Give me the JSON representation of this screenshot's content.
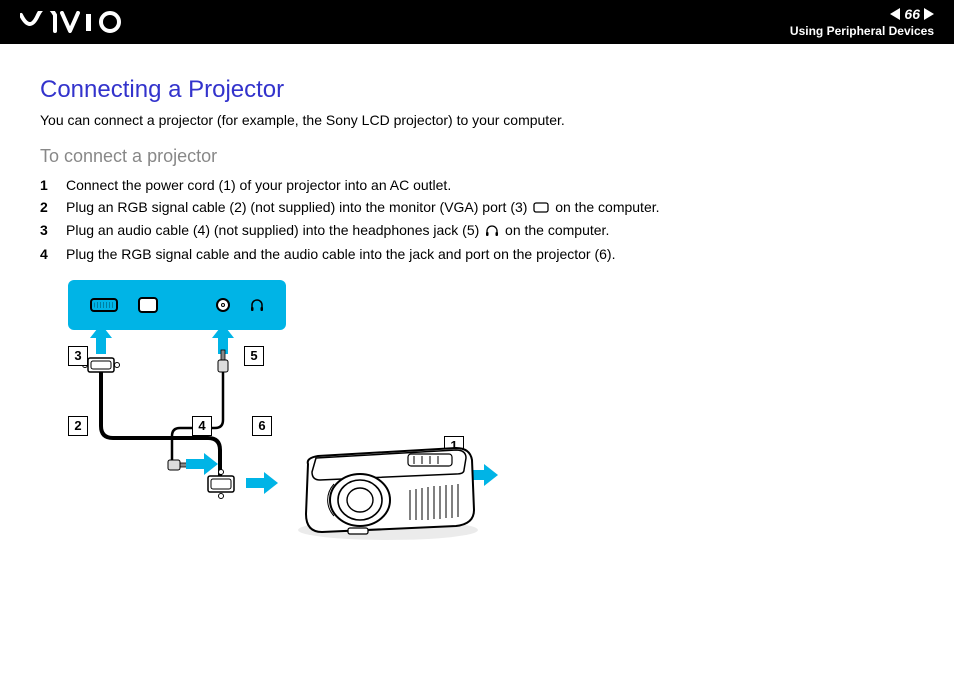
{
  "header": {
    "logo_alt": "VAIO",
    "page_number": "66",
    "section": "Using Peripheral Devices"
  },
  "title": "Connecting a Projector",
  "intro": "You can connect a projector (for example, the Sony LCD projector) to your computer.",
  "subtitle": "To connect a projector",
  "steps": [
    {
      "num": "1",
      "text_before": "Connect the power cord (1) of your projector into an AC outlet.",
      "icon": null,
      "text_after": ""
    },
    {
      "num": "2",
      "text_before": "Plug an RGB signal cable (2) (not supplied) into the monitor (VGA) port (3) ",
      "icon": "monitor-port-icon",
      "text_after": " on the computer."
    },
    {
      "num": "3",
      "text_before": "Plug an audio cable (4) (not supplied) into the headphones jack (5) ",
      "icon": "headphones-icon",
      "text_after": " on the computer."
    },
    {
      "num": "4",
      "text_before": "Plug the RGB signal cable and the audio cable into the jack and port on the projector (6).",
      "icon": null,
      "text_after": ""
    }
  ],
  "diagram": {
    "callouts": {
      "1": "1",
      "2": "2",
      "3": "3",
      "4": "4",
      "5": "5",
      "6": "6"
    },
    "icons": [
      "vga-port-icon",
      "monitor-port-icon",
      "audio-out-icon",
      "headphones-icon"
    ],
    "arrows": "cyan"
  }
}
